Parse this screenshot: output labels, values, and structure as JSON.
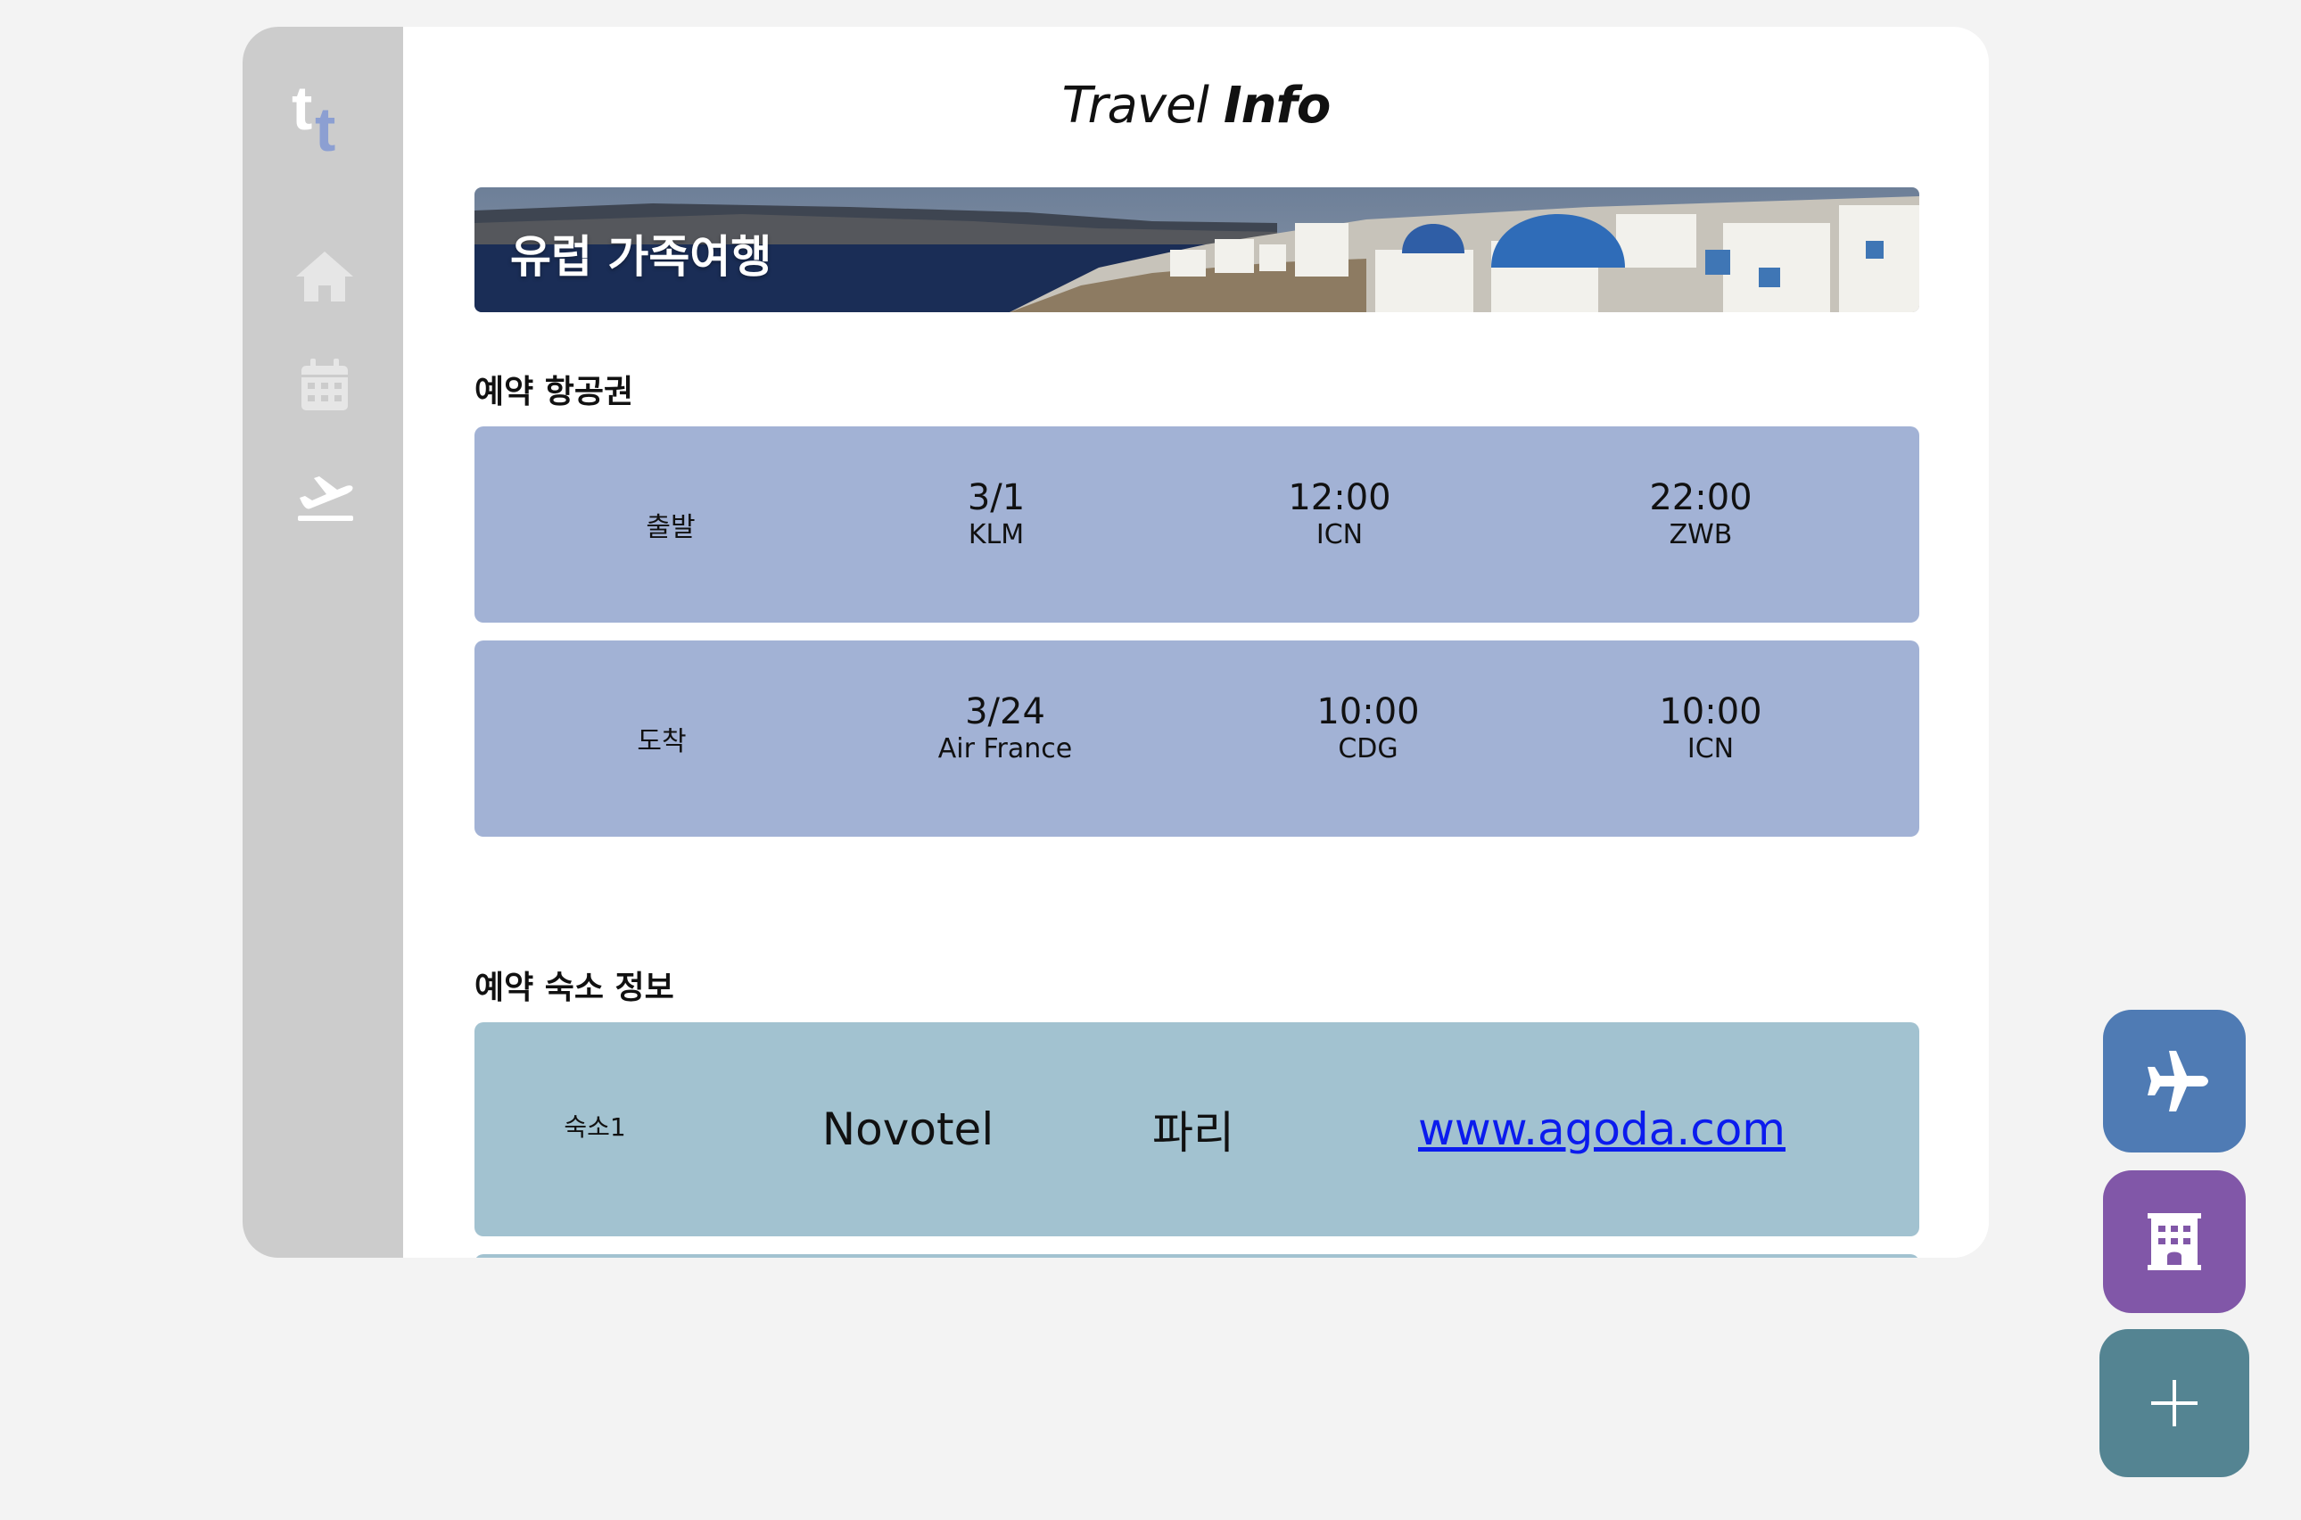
{
  "app": {
    "title_regular": "Travel",
    "title_bold": "Info",
    "logo_text": "tt"
  },
  "sidebar": {
    "items": [
      {
        "icon": "home-icon"
      },
      {
        "icon": "calendar-icon"
      },
      {
        "icon": "flight-departure-icon",
        "active": true
      }
    ]
  },
  "banner": {
    "title": "유럽 가족여행"
  },
  "flights": {
    "section_title": "예약 항공권",
    "rows": [
      {
        "label": "출발",
        "date": "3/1",
        "airline": "KLM",
        "dep_time": "12:00",
        "dep_airport": "ICN",
        "arr_time": "22:00",
        "arr_airport": "ZWB"
      },
      {
        "label": "도착",
        "date": "3/24",
        "airline": "Air France",
        "dep_time": "10:00",
        "dep_airport": "CDG",
        "arr_time": "10:00",
        "arr_airport": "ICN"
      }
    ]
  },
  "hotels": {
    "section_title": "예약 숙소 정보",
    "rows": [
      {
        "label": "숙소1",
        "name": "Novotel",
        "city": "파리",
        "link": "www.agoda.com"
      }
    ]
  },
  "fabs": [
    {
      "icon": "airplane-icon",
      "color": "#4f7bb4"
    },
    {
      "icon": "hotel-icon",
      "color": "#8157a8"
    },
    {
      "icon": "plus-icon",
      "color": "#548492"
    }
  ],
  "colors": {
    "background": "#f3f3f3",
    "sidebar": "#cccccc",
    "flight_card": "#a2b2d5",
    "hotel_card": "#a2c2d0",
    "link": "#0b1bee",
    "logo_accent": "#8c9fd2"
  }
}
